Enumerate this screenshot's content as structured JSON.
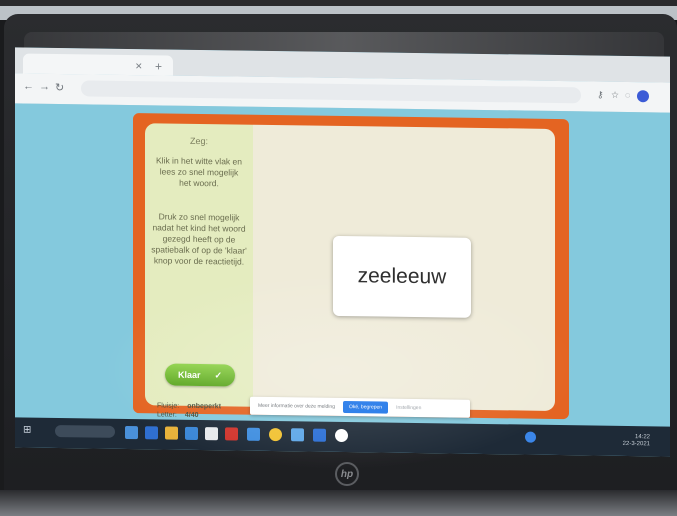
{
  "sidebar": {
    "title": "Zeg:",
    "instruction_1": "Klik in het witte vlak en lees zo snel mogelijk het woord.",
    "instruction_2": "Druk zo snel mogelijk nadat het kind het woord gezegd heeft op de spatiebalk of op de 'klaar' knop voor de reactietijd.",
    "done_button": "Klaar",
    "done_icon": "check-icon",
    "progress": {
      "label_1": "Fluisje:",
      "value_1": "onbeperkt",
      "label_2": "Letter:",
      "value_2": "4/40"
    }
  },
  "word_card": {
    "word": "zeeleeuw"
  },
  "cookie_bar": {
    "text": "Meer informatie over deze melding",
    "accept": "Oké, begrepen",
    "more": "Instellingen"
  },
  "taskbar": {
    "tray_time": "14:22",
    "tray_date": "22-3-2021"
  },
  "device": {
    "logo": "hp"
  }
}
